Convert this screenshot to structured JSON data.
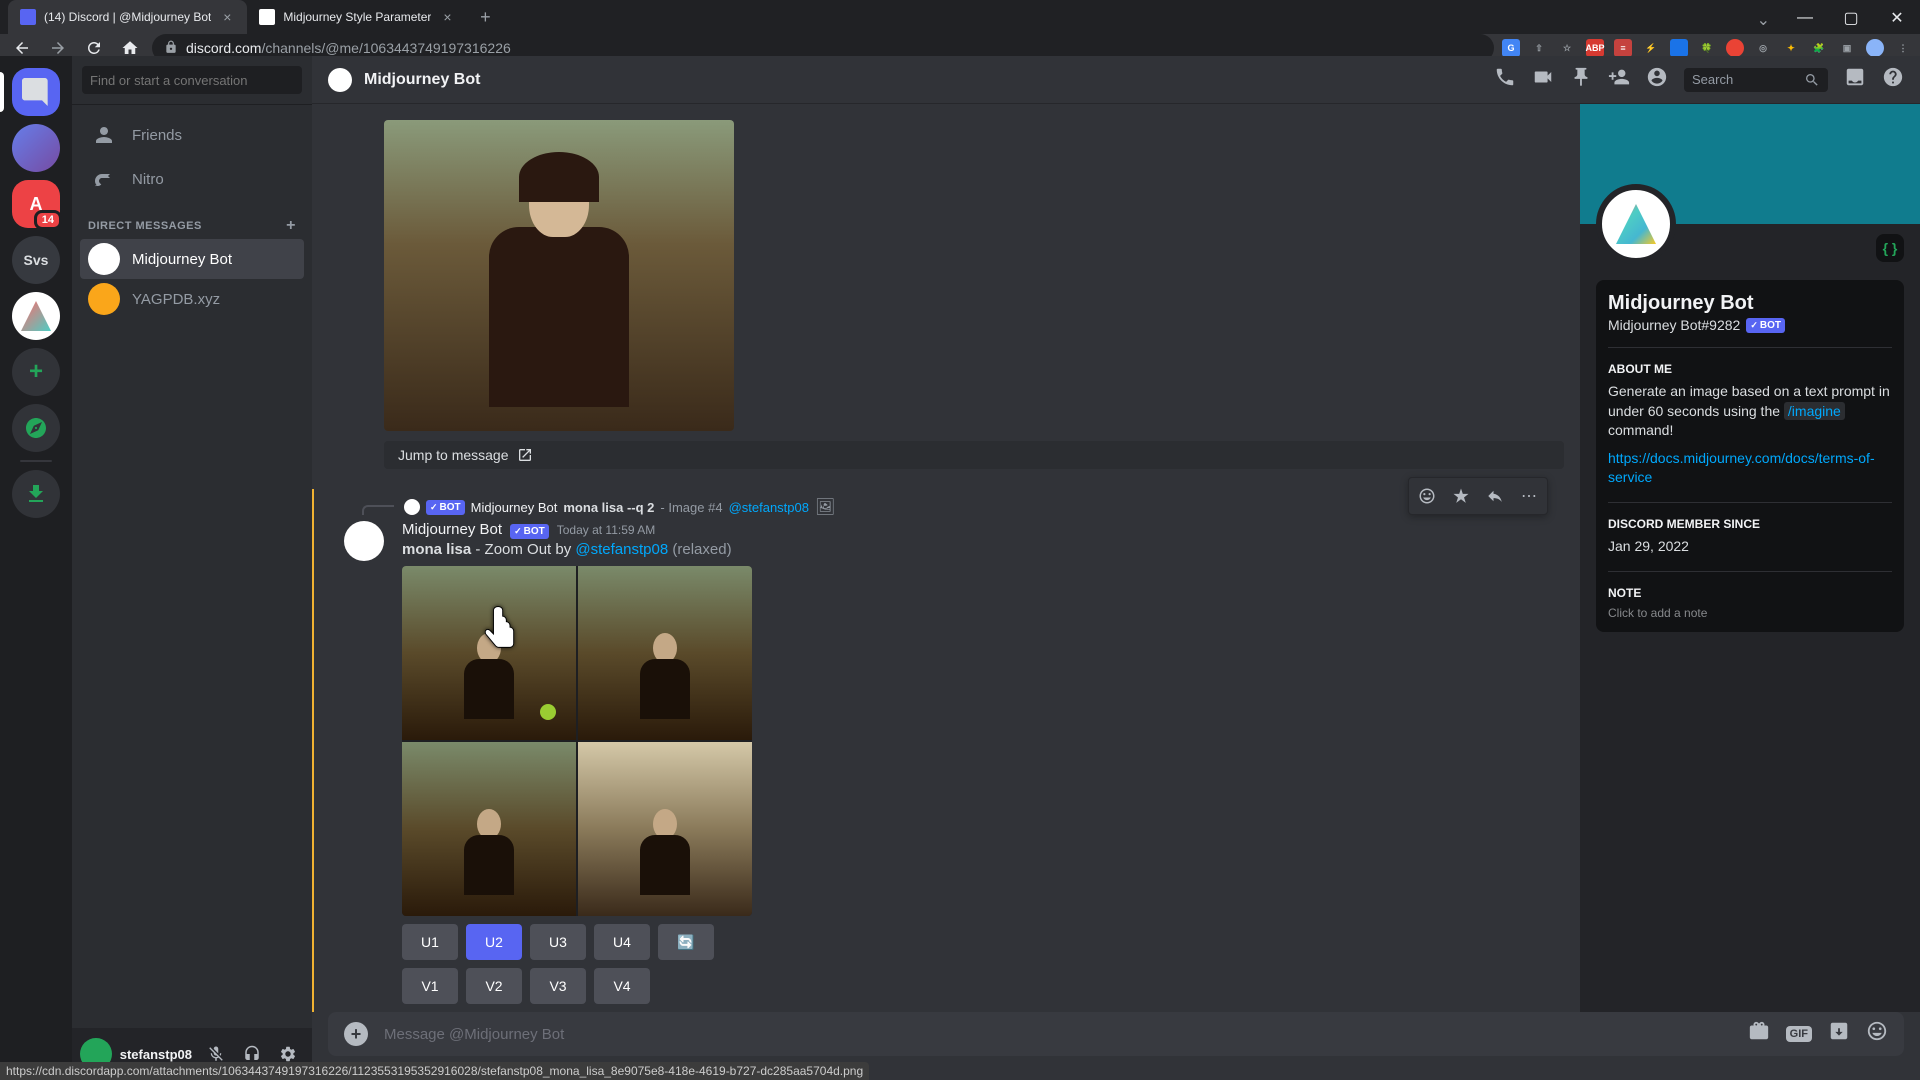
{
  "browser": {
    "tabs": [
      {
        "title": "(14) Discord | @Midjourney Bot",
        "active": true
      },
      {
        "title": "Midjourney Style Parameter",
        "active": false
      }
    ],
    "url_domain": "discord.com",
    "url_path": "/channels/@me/1063443749197316226",
    "extensions": [
      "G",
      "share",
      "star",
      "ABP",
      "1P",
      "⚡",
      "▦",
      "🍀",
      "◉",
      "◎",
      "✦",
      "🧩",
      "▢",
      "👤"
    ]
  },
  "status_url": "https://cdn.discordapp.com/attachments/1063443749197316226/1123553195352916028/stefanstp08_mona_lisa_8e9075e8-418e-4619-b727-dc285aa5704d.png",
  "servers": [
    {
      "name": "direct-messages",
      "label": "",
      "badge": null
    },
    {
      "name": "server-avatar",
      "label": "",
      "badge": null
    },
    {
      "name": "server-red",
      "label": "A",
      "badge": "14"
    },
    {
      "name": "server-svs",
      "label": "Svs",
      "badge": null
    },
    {
      "name": "server-mj",
      "label": "",
      "badge": null
    }
  ],
  "dm_sidebar": {
    "search_placeholder": "Find or start a conversation",
    "friends_label": "Friends",
    "nitro_label": "Nitro",
    "section_header": "DIRECT MESSAGES",
    "dms": [
      {
        "name": "Midjourney Bot",
        "active": true
      },
      {
        "name": "YAGPDB.xyz",
        "active": false
      }
    ],
    "user": {
      "name": "stefanstp08"
    }
  },
  "chat": {
    "header_title": "Midjourney Bot",
    "search_placeholder": "Search",
    "jump_label": "Jump to message",
    "reply": {
      "author": "Midjourney Bot",
      "bot_tag": "BOT",
      "prompt_bold": "mona lisa --q 2",
      "prompt_tail": " - Image #4 ",
      "mention": "@stefanstp08"
    },
    "message": {
      "author": "Midjourney Bot",
      "bot_tag": "BOT",
      "timestamp": "Today at 11:59 AM",
      "content_bold": "mona lisa",
      "content_mid": " - Zoom Out by ",
      "content_mention": "@stefanstp08",
      "content_tail": " (relaxed)"
    },
    "buttons_row1": [
      "U1",
      "U2",
      "U3",
      "U4"
    ],
    "refresh_icon": "🔄",
    "buttons_row2": [
      "V1",
      "V2",
      "V3",
      "V4"
    ],
    "input_placeholder": "Message @Midjourney Bot",
    "gif_label": "GIF"
  },
  "profile": {
    "name": "Midjourney Bot",
    "tag": "Midjourney Bot#9282",
    "bot_tag": "BOT",
    "about_heading": "ABOUT ME",
    "about_text_1": "Generate an image based on a text prompt in under 60 seconds using the ",
    "about_cmd": "/imagine",
    "about_text_2": " command!",
    "about_link": "https://docs.midjourney.com/docs/terms-of-service",
    "member_heading": "DISCORD MEMBER SINCE",
    "member_date": "Jan 29, 2022",
    "note_heading": "NOTE",
    "note_placeholder": "Click to add a note"
  }
}
